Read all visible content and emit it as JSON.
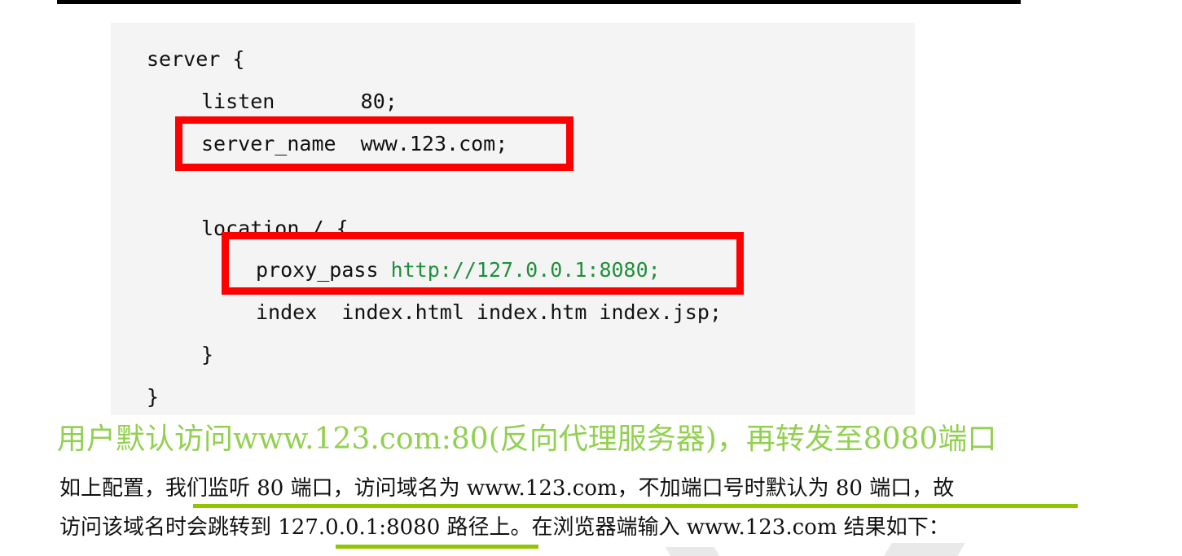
{
  "code": {
    "lines": [
      "server {",
      "listen       80;",
      "server_name  www.123.com;",
      "location / {",
      "proxy_pass ",
      "index  index.html index.htm index.jsp;",
      "}",
      "}"
    ],
    "proxy_url": "http://127.0.0.1:8080;"
  },
  "headline": "用户默认访问www.123.com:80(反向代理服务器)，再转发至8080端口",
  "paragraph": {
    "line1": "如上配置，我们监听 80 端口，访问域名为 www.123.com，不加端口号时默认为 80 端口，故",
    "line2": "访问该域名时会跳转到 127.0.0.1:8080 路径上。在浏览器端输入 www.123.com 结果如下："
  },
  "colors": {
    "highlight_box": "#ff0000",
    "headline": "#92d050",
    "underline": "#92c500",
    "code_bg": "#f4f4f4"
  }
}
